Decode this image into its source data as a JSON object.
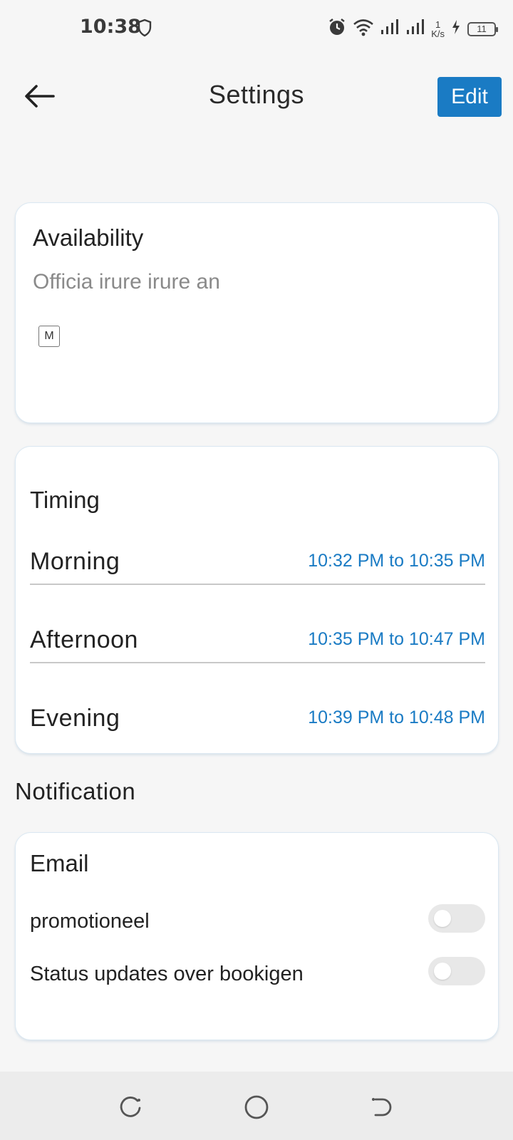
{
  "status_bar": {
    "time": "10:38",
    "net_speed_value": "1",
    "net_speed_unit": "K/s",
    "battery_level": "11",
    "icons": [
      "shield-icon",
      "alarm-icon",
      "wifi-icon",
      "signal-icon",
      "signal-icon",
      "charging-icon",
      "battery-icon"
    ]
  },
  "header": {
    "title": "Settings",
    "edit_label": "Edit",
    "back_icon": "arrow-left-icon"
  },
  "availability": {
    "title": "Availability",
    "description": "Officia irure irure an",
    "days": [
      "M"
    ]
  },
  "timing": {
    "title": "Timing",
    "slots": [
      {
        "label": "Morning",
        "range": "10:32 PM to 10:35 PM"
      },
      {
        "label": "Afternoon",
        "range": "10:35 PM to 10:47 PM"
      },
      {
        "label": "Evening",
        "range": "10:39 PM to 10:48 PM"
      }
    ]
  },
  "notification": {
    "section_title": "Notification",
    "email": {
      "title": "Email",
      "prefs": [
        {
          "label": "promotioneel",
          "enabled": false
        },
        {
          "label": "Status updates over bookigen",
          "enabled": false
        }
      ]
    }
  },
  "colors": {
    "accent": "#1a7bc4",
    "background": "#f6f6f6",
    "card": "#ffffff",
    "muted_text": "#8a8a8a"
  },
  "nav_bar": {
    "icons": [
      "recent-apps-icon",
      "home-icon",
      "back-icon"
    ]
  }
}
